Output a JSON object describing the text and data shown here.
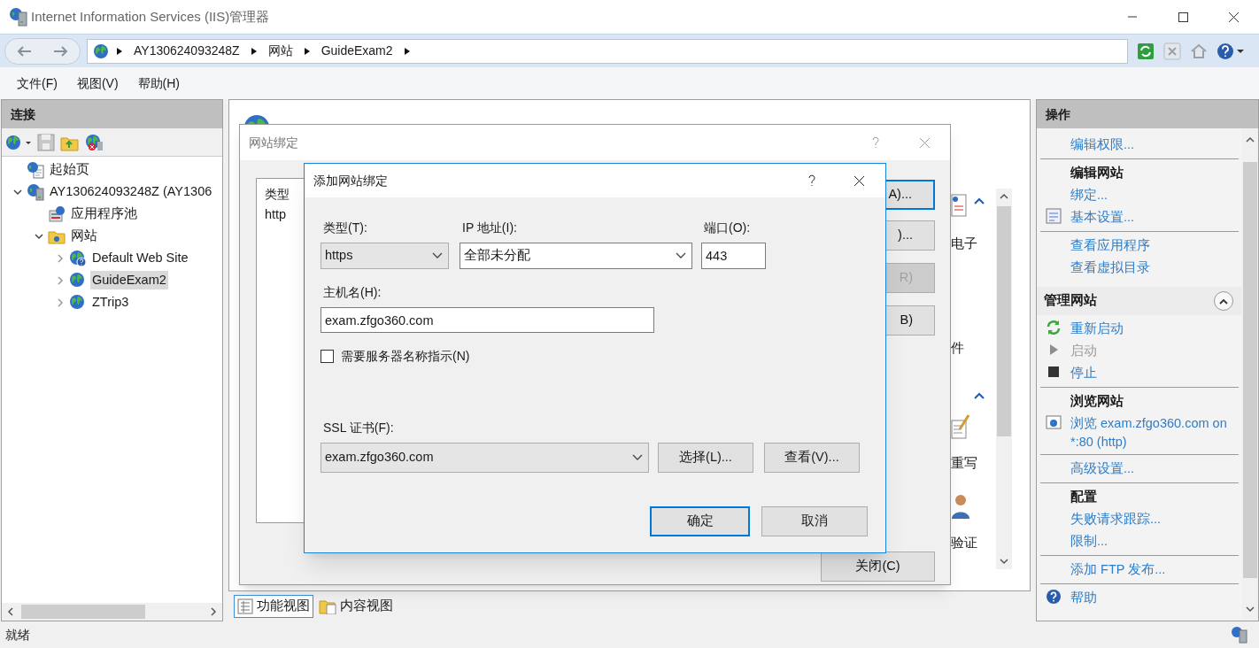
{
  "window": {
    "title": "Internet Information Services (IIS)管理器"
  },
  "address_bar": {
    "crumbs": [
      "AY130624093248Z",
      "网站",
      "GuideExam2"
    ]
  },
  "menu": [
    "文件(F)",
    "视图(V)",
    "帮助(H)"
  ],
  "connections": {
    "title": "连接",
    "tree": [
      {
        "label": "起始页",
        "kind": "start",
        "selected": false
      },
      {
        "label": "AY130624093248Z (AY1306",
        "kind": "server",
        "selected": false,
        "expanded": true,
        "children": [
          {
            "label": "应用程序池",
            "kind": "pool",
            "selected": false
          },
          {
            "label": "网站",
            "kind": "sites",
            "selected": false,
            "expanded": true,
            "children": [
              {
                "label": "Default Web Site",
                "kind": "default-site",
                "selected": false,
                "expanded": false
              },
              {
                "label": "GuideExam2",
                "kind": "site",
                "selected": true,
                "expanded": false
              },
              {
                "label": "ZTrip3",
                "kind": "site",
                "selected": false,
                "expanded": false
              }
            ]
          }
        ]
      }
    ]
  },
  "center": {
    "feature_labels": [
      {
        "label": "电子",
        "kind": "mail"
      },
      {
        "label": "件",
        "kind": "none"
      },
      {
        "label": "重写",
        "kind": "rewrite"
      },
      {
        "label": "验证",
        "kind": "auth"
      }
    ],
    "view_tabs": [
      {
        "label": "功能视图",
        "selected": true
      },
      {
        "label": "内容视图",
        "selected": false
      }
    ]
  },
  "bindings_dialog": {
    "title": "网站绑定",
    "columns": [
      "类型"
    ],
    "rows": [
      [
        "http"
      ]
    ],
    "buttons": [
      {
        "label": "A)...",
        "disabled": false,
        "default": true
      },
      {
        "label": ")...",
        "disabled": false,
        "default": false
      },
      {
        "label": "R)",
        "disabled": true,
        "default": false
      },
      {
        "label": "B)",
        "disabled": false,
        "default": false
      },
      {
        "label": "关闭(C)",
        "disabled": false,
        "default": false
      }
    ]
  },
  "add_binding_dialog": {
    "title": "添加网站绑定",
    "type": {
      "label": "类型(T):",
      "value": "https"
    },
    "ip": {
      "label": "IP 地址(I):",
      "value": "全部未分配"
    },
    "port": {
      "label": "端口(O):",
      "value": "443"
    },
    "host": {
      "label": "主机名(H):",
      "value": "exam.zfgo360.com"
    },
    "sni": {
      "label": "需要服务器名称指示(N)",
      "checked": false
    },
    "ssl": {
      "label": "SSL 证书(F):",
      "value": "exam.zfgo360.com"
    },
    "cert_buttons": [
      "选择(L)...",
      "查看(V)..."
    ],
    "buttons": [
      {
        "label": "确定",
        "default": true
      },
      {
        "label": "取消",
        "default": false
      }
    ]
  },
  "actions": {
    "title": "操作",
    "groups": [
      {
        "sections": [
          {
            "items": [
              {
                "label": "编辑权限...",
                "kind": "link",
                "disabled": false
              }
            ]
          },
          {
            "heading": "编辑网站",
            "items": [
              {
                "label": "绑定...",
                "kind": "link",
                "disabled": false
              },
              {
                "label": "基本设置...",
                "kind": "settings",
                "disabled": false
              }
            ]
          },
          {
            "items": [
              {
                "label": "查看应用程序",
                "kind": "link",
                "disabled": false
              },
              {
                "label": "查看虚拟目录",
                "kind": "link",
                "disabled": false
              }
            ]
          }
        ]
      },
      {
        "title": "管理网站",
        "expanded": true,
        "sections": [
          {
            "items": [
              {
                "label": "重新启动",
                "kind": "restart",
                "disabled": false
              },
              {
                "label": "启动",
                "kind": "start",
                "disabled": true
              },
              {
                "label": "停止",
                "kind": "stop",
                "disabled": false
              }
            ]
          },
          {
            "heading": "浏览网站",
            "items": [
              {
                "label": "浏览 exam.zfgo360.com on *:80 (http)",
                "kind": "browse",
                "disabled": false
              }
            ]
          },
          {
            "items": [
              {
                "label": "高级设置...",
                "kind": "link",
                "disabled": false
              }
            ]
          },
          {
            "heading": "配置",
            "items": [
              {
                "label": "失败请求跟踪...",
                "kind": "link",
                "disabled": false
              },
              {
                "label": "限制...",
                "kind": "link",
                "disabled": false
              }
            ]
          },
          {
            "items": [
              {
                "label": "添加 FTP 发布...",
                "kind": "link",
                "disabled": false
              }
            ]
          },
          {
            "items": [
              {
                "label": "帮助",
                "kind": "help",
                "disabled": false
              }
            ]
          }
        ]
      }
    ]
  },
  "status_bar": {
    "text": "就绪"
  }
}
